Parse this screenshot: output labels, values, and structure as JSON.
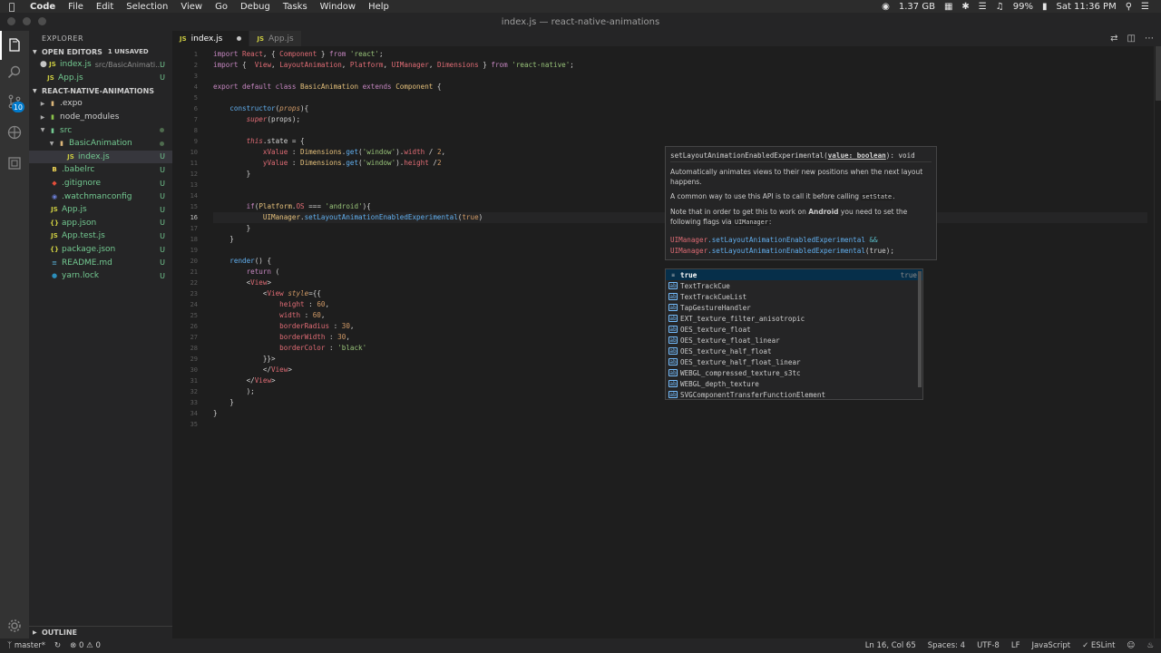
{
  "menubar": {
    "apple_icon": "apple-logo",
    "items": [
      "Code",
      "File",
      "Edit",
      "Selection",
      "View",
      "Go",
      "Debug",
      "Tasks",
      "Window",
      "Help"
    ],
    "memory": "1.37 GB",
    "battery": "99%",
    "clock": "Sat 11:36 PM"
  },
  "window": {
    "title": "index.js — react-native-animations"
  },
  "activity": {
    "scm_badge": "10"
  },
  "sidebar": {
    "title": "EXPLORER",
    "open_editors": {
      "label": "OPEN EDITORS",
      "unsaved": "1 UNSAVED"
    },
    "open_files": [
      {
        "icon": "JS",
        "name": "index.js",
        "desc": "src/BasicAnimati...",
        "status": "U",
        "dirty": true
      },
      {
        "icon": "JS",
        "name": "App.js",
        "desc": "",
        "status": "U",
        "dirty": false
      }
    ],
    "project": "REACT-NATIVE-ANIMATIONS",
    "tree": [
      {
        "name": ".expo",
        "kind": "folder",
        "indent": 1,
        "status": ""
      },
      {
        "name": "node_modules",
        "kind": "folder",
        "indent": 1,
        "status": ""
      },
      {
        "name": "src",
        "kind": "folder-open",
        "indent": 1,
        "status": "dot"
      },
      {
        "name": "BasicAnimation",
        "kind": "folder-open",
        "indent": 2,
        "status": "dot"
      },
      {
        "name": "index.js",
        "kind": "js",
        "indent": 3,
        "status": "U",
        "active": true
      },
      {
        "name": ".babelrc",
        "kind": "babel",
        "indent": 1,
        "status": "U"
      },
      {
        "name": ".gitignore",
        "kind": "git",
        "indent": 1,
        "status": "U"
      },
      {
        "name": ".watchmanconfig",
        "kind": "wm",
        "indent": 1,
        "status": "U"
      },
      {
        "name": "App.js",
        "kind": "js",
        "indent": 1,
        "status": "U"
      },
      {
        "name": "app.json",
        "kind": "json",
        "indent": 1,
        "status": "U"
      },
      {
        "name": "App.test.js",
        "kind": "js",
        "indent": 1,
        "status": "U"
      },
      {
        "name": "package.json",
        "kind": "json",
        "indent": 1,
        "status": "U"
      },
      {
        "name": "README.md",
        "kind": "md",
        "indent": 1,
        "status": "U"
      },
      {
        "name": "yarn.lock",
        "kind": "yarn",
        "indent": 1,
        "status": "U"
      }
    ],
    "outline": "OUTLINE"
  },
  "tabs": [
    {
      "icon": "JS",
      "label": "index.js",
      "active": true,
      "dirty": true
    },
    {
      "icon": "JS",
      "label": "App.js",
      "active": false,
      "dirty": false
    }
  ],
  "editor": {
    "current_line": 16,
    "lines": [
      [
        [
          "import ",
          "kw"
        ],
        [
          "React",
          "var"
        ],
        [
          ", { ",
          ""
        ],
        [
          "Component",
          "var"
        ],
        [
          " } ",
          ""
        ],
        [
          "from",
          "kw"
        ],
        [
          " ",
          ""
        ],
        [
          "'react'",
          "pgreen"
        ],
        [
          ";",
          ""
        ]
      ],
      [
        [
          "import ",
          "kw"
        ],
        [
          "{  ",
          ""
        ],
        [
          "View",
          "var"
        ],
        [
          ", ",
          ""
        ],
        [
          "LayoutAnimation",
          "var"
        ],
        [
          ", ",
          ""
        ],
        [
          "Platform",
          "var"
        ],
        [
          ", ",
          ""
        ],
        [
          "UIManager",
          "var"
        ],
        [
          ", ",
          ""
        ],
        [
          "Dimensions",
          "var"
        ],
        [
          " } ",
          ""
        ],
        [
          "from",
          "kw"
        ],
        [
          " ",
          ""
        ],
        [
          "'react-native'",
          "pgreen"
        ],
        [
          ";",
          ""
        ]
      ],
      [],
      [
        [
          "export ",
          "kw"
        ],
        [
          "default ",
          "kw"
        ],
        [
          "class ",
          "kw"
        ],
        [
          "BasicAnimation ",
          "pyellow"
        ],
        [
          "extends ",
          "kw"
        ],
        [
          "Component",
          "pyellow"
        ],
        [
          " {",
          ""
        ]
      ],
      [],
      [
        [
          "    ",
          ""
        ],
        [
          "constructor",
          "pblue"
        ],
        [
          "(",
          ""
        ],
        [
          "props",
          "porange it"
        ],
        [
          "){",
          ""
        ]
      ],
      [
        [
          "        ",
          ""
        ],
        [
          "super",
          "pred it"
        ],
        [
          "(props);",
          ""
        ]
      ],
      [],
      [
        [
          "        ",
          ""
        ],
        [
          "this",
          "pred it"
        ],
        [
          ".state = {",
          ""
        ]
      ],
      [
        [
          "            ",
          ""
        ],
        [
          "xValue",
          "pred"
        ],
        [
          " : ",
          ""
        ],
        [
          "Dimensions",
          "pyellow"
        ],
        [
          ".",
          ""
        ],
        [
          "get",
          "pblue"
        ],
        [
          "(",
          ""
        ],
        [
          "'window'",
          "pgreen"
        ],
        [
          ").",
          ""
        ],
        [
          "width",
          "pred"
        ],
        [
          " / ",
          ""
        ],
        [
          "2",
          "porange"
        ],
        [
          ",",
          ""
        ]
      ],
      [
        [
          "            ",
          ""
        ],
        [
          "yValue",
          "pred"
        ],
        [
          " : ",
          ""
        ],
        [
          "Dimensions",
          "pyellow"
        ],
        [
          ".",
          ""
        ],
        [
          "get",
          "pblue"
        ],
        [
          "(",
          ""
        ],
        [
          "'window'",
          "pgreen"
        ],
        [
          ").",
          ""
        ],
        [
          "height",
          "pred"
        ],
        [
          " /",
          ""
        ],
        [
          "2",
          "porange"
        ]
      ],
      [
        [
          "        }",
          ""
        ]
      ],
      [],
      [],
      [
        [
          "        ",
          ""
        ],
        [
          "if",
          "kw"
        ],
        [
          "(",
          ""
        ],
        [
          "Platform",
          "pyellow"
        ],
        [
          ".",
          ""
        ],
        [
          "OS",
          "pred"
        ],
        [
          " === ",
          ""
        ],
        [
          "'android'",
          "pgreen"
        ],
        [
          "){",
          ""
        ]
      ],
      [
        [
          "            ",
          ""
        ],
        [
          "UIManager",
          "pyellow"
        ],
        [
          ".",
          ""
        ],
        [
          "setLayoutAnimationEnabledExperimental",
          "pblue"
        ],
        [
          "(",
          ""
        ],
        [
          "true",
          "porange"
        ],
        [
          ")",
          ""
        ]
      ],
      [
        [
          "        }",
          ""
        ]
      ],
      [
        [
          "    }",
          ""
        ]
      ],
      [],
      [
        [
          "    ",
          ""
        ],
        [
          "render",
          "pblue"
        ],
        [
          "() {",
          ""
        ]
      ],
      [
        [
          "        ",
          ""
        ],
        [
          "return",
          "kw"
        ],
        [
          " (",
          ""
        ]
      ],
      [
        [
          "        ",
          ""
        ],
        [
          "<",
          ""
        ],
        [
          "View",
          "pred"
        ],
        [
          ">",
          ""
        ]
      ],
      [
        [
          "            ",
          ""
        ],
        [
          "<",
          ""
        ],
        [
          "View",
          "pred"
        ],
        [
          " ",
          ""
        ],
        [
          "style",
          "porange it"
        ],
        [
          "={{",
          ""
        ]
      ],
      [
        [
          "                ",
          ""
        ],
        [
          "height",
          "pred"
        ],
        [
          " : ",
          ""
        ],
        [
          "60",
          "porange"
        ],
        [
          ",",
          ""
        ]
      ],
      [
        [
          "                ",
          ""
        ],
        [
          "width",
          "pred"
        ],
        [
          " : ",
          ""
        ],
        [
          "60",
          "porange"
        ],
        [
          ",",
          ""
        ]
      ],
      [
        [
          "                ",
          ""
        ],
        [
          "borderRadius",
          "pred"
        ],
        [
          " : ",
          ""
        ],
        [
          "30",
          "porange"
        ],
        [
          ",",
          ""
        ]
      ],
      [
        [
          "                ",
          ""
        ],
        [
          "borderWidth",
          "pred"
        ],
        [
          " : ",
          ""
        ],
        [
          "30",
          "porange"
        ],
        [
          ",",
          ""
        ]
      ],
      [
        [
          "                ",
          ""
        ],
        [
          "borderColor",
          "pred"
        ],
        [
          " : ",
          ""
        ],
        [
          "'black'",
          "pgreen"
        ]
      ],
      [
        [
          "            }}>",
          ""
        ]
      ],
      [
        [
          "            ",
          ""
        ],
        [
          "</",
          ""
        ],
        [
          "View",
          "pred"
        ],
        [
          ">",
          ""
        ]
      ],
      [
        [
          "        ",
          ""
        ],
        [
          "</",
          ""
        ],
        [
          "View",
          "pred"
        ],
        [
          ">",
          ""
        ]
      ],
      [
        [
          "        );",
          ""
        ]
      ],
      [
        [
          "    }",
          ""
        ]
      ],
      [
        [
          "}",
          ""
        ]
      ],
      []
    ]
  },
  "hover": {
    "sig_name": "setLayoutAnimationEnabledExperimental(",
    "sig_param": "value: boolean",
    "sig_ret": "): void",
    "p1": "Automatically animates views to their new positions when the next layout happens.",
    "p2_a": "A common way to use this API is to call it before calling ",
    "p2_code": "setState",
    "p2_b": ".",
    "p3_a": "Note that in order to get this to work on ",
    "p3_bold": "Android",
    "p3_b": " you need to set the following flags via ",
    "p3_code": "UIManager",
    "p3_c": ":",
    "ex1_obj": "UIManager",
    "ex1_method": ".setLayoutAnimationEnabledExperimental",
    "ex1_op": " &&",
    "ex2_obj": "UIManager",
    "ex2_method": ".setLayoutAnimationEnabledExperimental",
    "ex2_args": "(true);"
  },
  "suggest": {
    "items": [
      {
        "kind": "keyword",
        "label": "true",
        "match": "true",
        "detail": "true"
      },
      {
        "kind": "ref",
        "label": "TextTrackCue",
        "match": ""
      },
      {
        "kind": "ref",
        "label": "TextTrackCueList",
        "match": ""
      },
      {
        "kind": "ref",
        "label": "TapGestureHandler",
        "match": ""
      },
      {
        "kind": "ref",
        "label": "EXT_texture_filter_anisotropic",
        "match": ""
      },
      {
        "kind": "ref",
        "label": "OES_texture_float",
        "match": ""
      },
      {
        "kind": "ref",
        "label": "OES_texture_float_linear",
        "match": ""
      },
      {
        "kind": "ref",
        "label": "OES_texture_half_float",
        "match": ""
      },
      {
        "kind": "ref",
        "label": "OES_texture_half_float_linear",
        "match": ""
      },
      {
        "kind": "ref",
        "label": "WEBGL_compressed_texture_s3tc",
        "match": ""
      },
      {
        "kind": "ref",
        "label": "WEBGL_depth_texture",
        "match": ""
      },
      {
        "kind": "ref",
        "label": "SVGComponentTransferFunctionElement",
        "match": ""
      }
    ]
  },
  "statusbar": {
    "branch": "master*",
    "errors": "0",
    "warnings": "0",
    "position": "Ln 16, Col 65",
    "spaces": "Spaces: 4",
    "encoding": "UTF-8",
    "eol": "LF",
    "language": "JavaScript",
    "eslint": "ESLint"
  },
  "colors": {
    "accent": "#007acc",
    "untracked": "#73c991",
    "background": "#1e1e1e",
    "sidebar": "#252526"
  }
}
